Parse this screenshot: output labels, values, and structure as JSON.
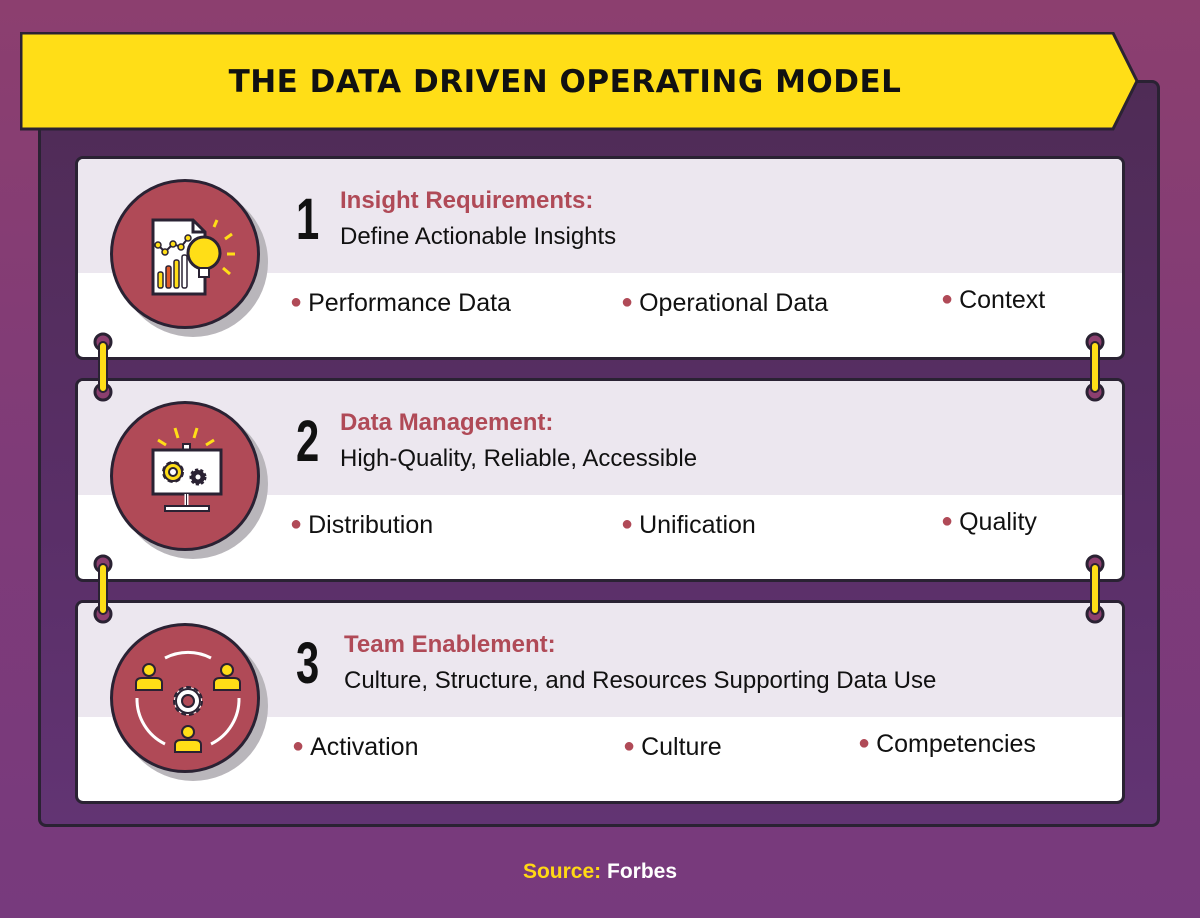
{
  "title": "THE DATA DRIVEN OPERATING MODEL",
  "colors": {
    "background": "#8c3f6f",
    "frame": "#55305e",
    "banner": "#ffde17",
    "accent": "#b04a57",
    "card_top": "#ece7ef",
    "outline": "#2a2233"
  },
  "steps": [
    {
      "number": "1",
      "heading": "Insight Requirements:",
      "subheading": "Define Actionable Insights",
      "icon": "report-lightbulb-icon",
      "bullets": [
        "Performance Data",
        "Operational Data",
        "Context"
      ]
    },
    {
      "number": "2",
      "heading": "Data Management:",
      "subheading": "High-Quality, Reliable, Accessible",
      "icon": "presentation-gears-icon",
      "bullets": [
        "Distribution",
        "Unification",
        "Quality"
      ]
    },
    {
      "number": "3",
      "heading": "Team Enablement:",
      "subheading": "Culture, Structure, and Resources Supporting Data Use",
      "icon": "team-gear-icon",
      "bullets": [
        "Activation",
        "Culture",
        "Competencies"
      ]
    }
  ],
  "source": {
    "label": "Source:",
    "value": "Forbes"
  }
}
